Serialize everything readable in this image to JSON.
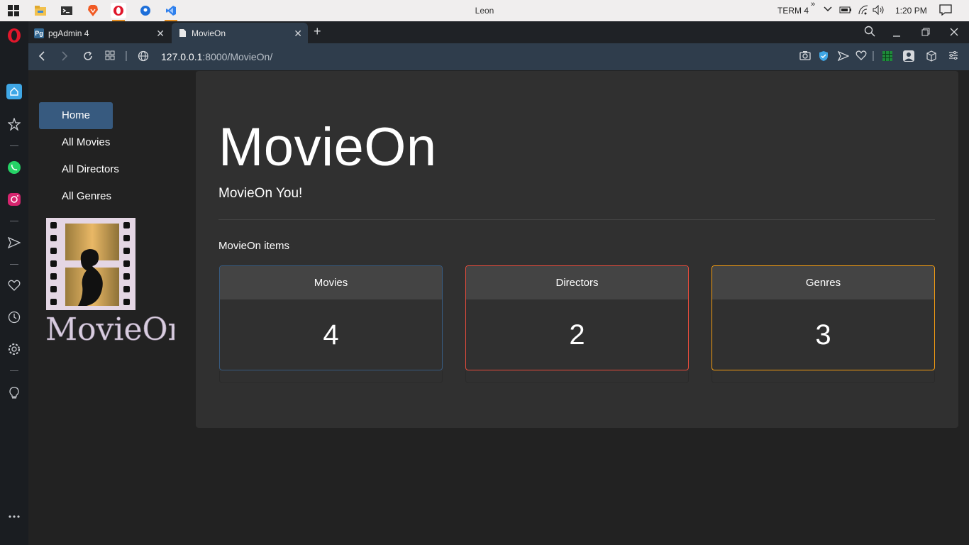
{
  "taskbar": {
    "window_title": "Leon",
    "tray_label": "TERM 4",
    "tray_chevron": "»",
    "time": "1:20 PM"
  },
  "tabs": [
    {
      "label": "pgAdmin 4",
      "favicon": "Pg"
    },
    {
      "label": "MovieOn"
    }
  ],
  "address": {
    "host": "127.0.0.1",
    "rest": ":8000/MovieOn/"
  },
  "nav": {
    "items": [
      {
        "label": "Home",
        "active": true
      },
      {
        "label": "All Movies"
      },
      {
        "label": "All Directors"
      },
      {
        "label": "All Genres"
      }
    ]
  },
  "logo": {
    "text": "MovieOn"
  },
  "hero": {
    "title": "MovieOn",
    "subtitle": "MovieOn You!",
    "section_title": "MovieOn items"
  },
  "cards": [
    {
      "title": "Movies",
      "count": "4",
      "border_color": "#375a7f"
    },
    {
      "title": "Directors",
      "count": "2",
      "border_color": "#e74c3c"
    },
    {
      "title": "Genres",
      "count": "3",
      "border_color": "#f39c12"
    }
  ],
  "colors": {
    "accent": "#375a7f",
    "page_bg": "#222222",
    "panel_bg": "#303030"
  }
}
